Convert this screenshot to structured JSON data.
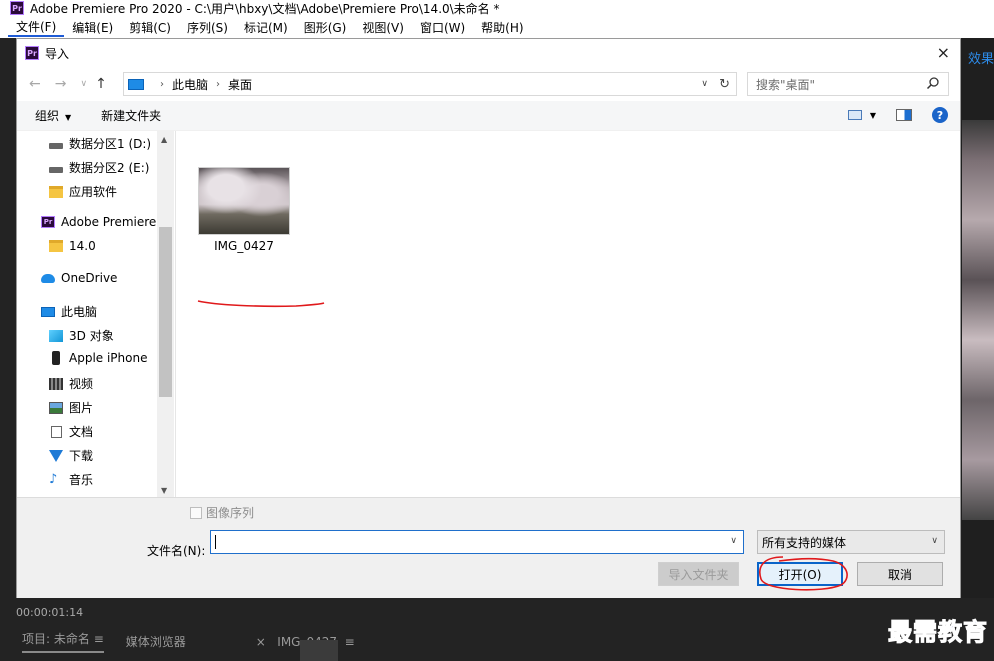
{
  "app": {
    "logo_text": "Pr",
    "title": "Adobe Premiere Pro 2020 - C:\\用户\\hbxy\\文档\\Adobe\\Premiere Pro\\14.0\\未命名 *",
    "menu": [
      "文件(F)",
      "编辑(E)",
      "剪辑(C)",
      "序列(S)",
      "标记(M)",
      "图形(G)",
      "视图(V)",
      "窗口(W)",
      "帮助(H)"
    ],
    "right_panel_label": "效果",
    "timecode": "00:00:01:14",
    "bottom_tabs": {
      "project": "项目: 未命名",
      "project_icon": "≡",
      "media_browser": "媒体浏览器",
      "clip_close": "×",
      "clip": "IMG_0427",
      "clip_icon": "≡"
    },
    "watermark": "最需教育"
  },
  "dialog": {
    "title": "导入",
    "close_glyph": "×",
    "nav": {
      "back": "←",
      "forward": "→",
      "recent": "∨",
      "up": "↑",
      "sep": "›",
      "caret": "∨",
      "refresh": "↻"
    },
    "address": {
      "crumbs": [
        "此电脑",
        "桌面"
      ]
    },
    "search_placeholder": "搜索\"桌面\"",
    "toolbar": {
      "organize": "组织",
      "new_folder": "新建文件夹"
    },
    "sidebar": [
      {
        "label": "数据分区1 (D:)",
        "icon": "drive-icon"
      },
      {
        "label": "数据分区2 (E:)",
        "icon": "drive-icon"
      },
      {
        "label": "应用软件",
        "icon": "folder-icon"
      },
      {
        "label": "Adobe Premiere",
        "icon": "premiere-icon"
      },
      {
        "label": "14.0",
        "icon": "folder-icon"
      },
      {
        "label": "OneDrive",
        "icon": "cloud-icon"
      },
      {
        "label": "此电脑",
        "icon": "computer-icon"
      },
      {
        "label": "3D 对象",
        "icon": "cube-icon"
      },
      {
        "label": "Apple iPhone",
        "icon": "phone-icon"
      },
      {
        "label": "视频",
        "icon": "video-icon"
      },
      {
        "label": "图片",
        "icon": "picture-icon"
      },
      {
        "label": "文档",
        "icon": "document-icon"
      },
      {
        "label": "下载",
        "icon": "download-icon"
      },
      {
        "label": "音乐",
        "icon": "music-icon"
      }
    ],
    "files": [
      {
        "name": "IMG_0427"
      }
    ],
    "image_sequence_label": "图像序列",
    "filename_label": "文件名(N):",
    "filename_value": "",
    "file_type": "所有支持的媒体",
    "buttons": {
      "import_folder": "导入文件夹",
      "open": "打开(O)",
      "cancel": "取消"
    }
  },
  "colors": {
    "accent_blue": "#1f6fcb",
    "annotation_red": "#e0191b",
    "watermark_blue": "#1036c8"
  }
}
